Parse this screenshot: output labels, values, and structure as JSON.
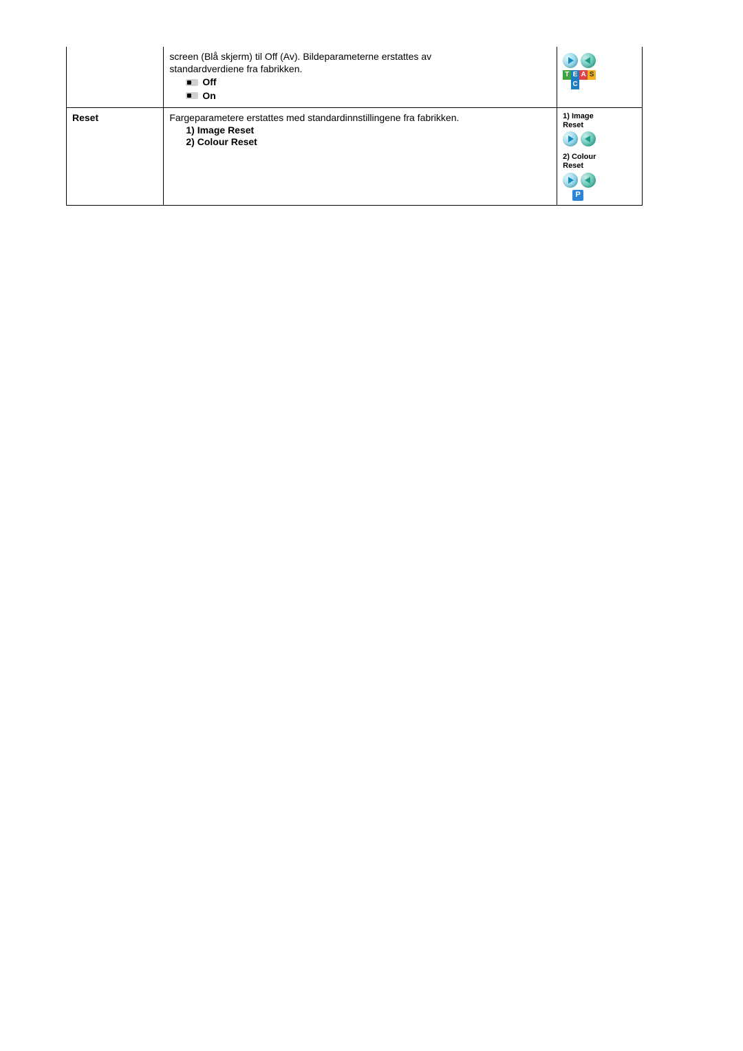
{
  "row1": {
    "label": "",
    "desc_line1": "screen (Blå skjerm) til Off (Av). Bildeparameterne erstattes av",
    "desc_line2": "standardverdiene fra fabrikken.",
    "option_off": "Off",
    "option_on": "On",
    "teas_T": "T",
    "teas_E": "E",
    "teas_A": "A",
    "teas_S": "S",
    "teas_C": "C"
  },
  "row2": {
    "label": "Reset",
    "desc_intro": "Fargeparametere erstattes med standardinnstillingene fra fabrikken.",
    "item1": "1) Image Reset",
    "item2": "2) Colour Reset",
    "side_label1a": "1) Image",
    "side_label1b": "Reset",
    "side_label2a": "2) Colour",
    "side_label2b": "Reset",
    "p_label": "P"
  }
}
